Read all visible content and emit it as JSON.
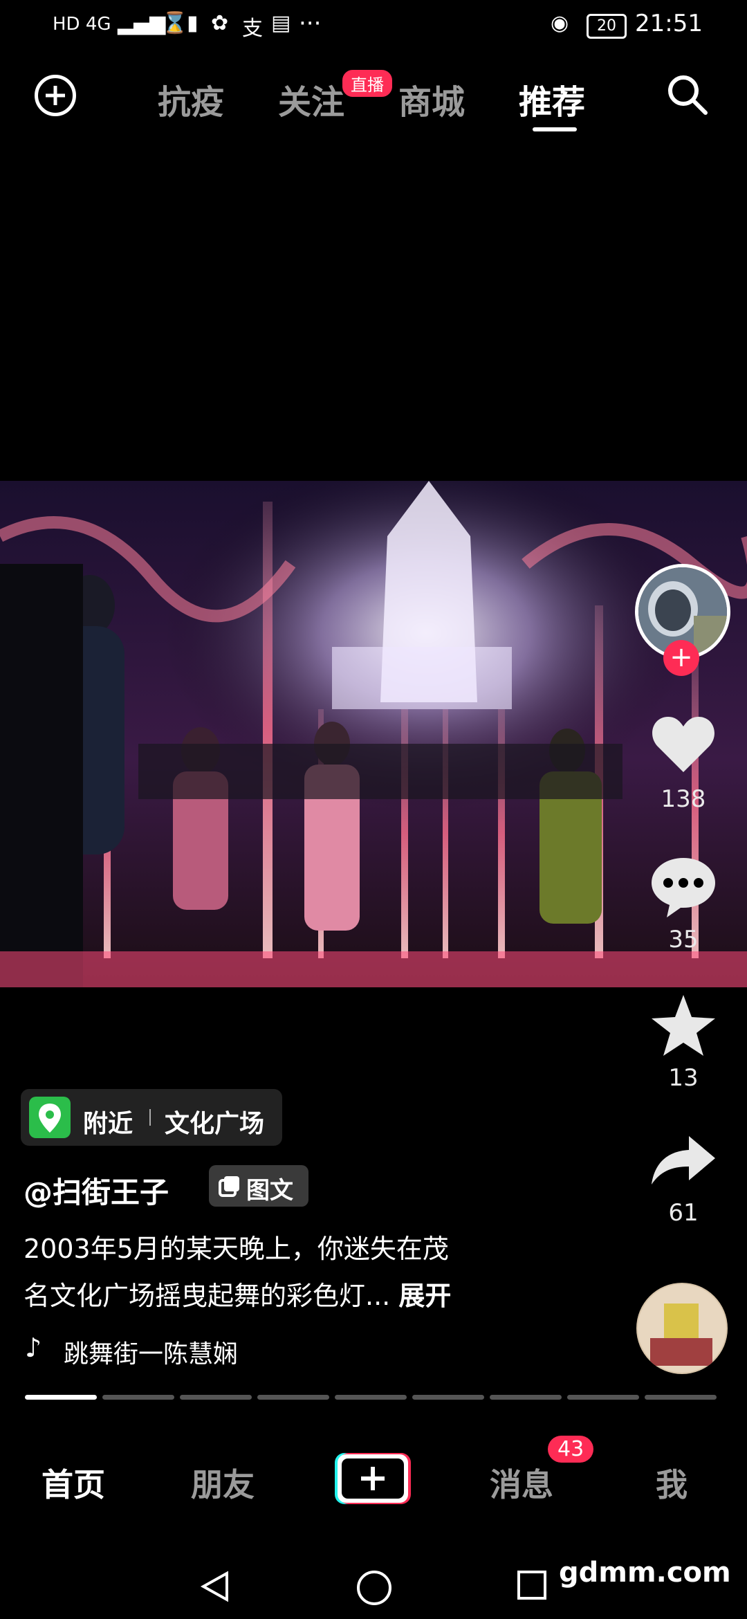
{
  "status_bar": {
    "left_icons_text": "HD 4G",
    "more": "···",
    "battery": "20",
    "time": "21:51"
  },
  "top_nav": {
    "tabs": [
      {
        "label": "抗疫"
      },
      {
        "label": "关注",
        "badge": "直播"
      },
      {
        "label": "商城"
      },
      {
        "label": "推荐",
        "active": true
      }
    ]
  },
  "right_rail": {
    "likes": "138",
    "comments": "35",
    "favorites": "13",
    "shares": "61"
  },
  "post": {
    "location_tag": "附近",
    "location_name": "文化广场",
    "username": "@扫街王子",
    "type_label": "图文",
    "description_line1": "2003年5月的某天晚上，你迷失在茂",
    "description_line2": "名文化广场摇曳起舞的彩色灯...",
    "expand": "展开",
    "music": "跳舞街一陈慧娴",
    "progress": {
      "segments": 9,
      "current": 1
    }
  },
  "bottom_nav": {
    "home": "首页",
    "friends": "朋友",
    "messages": "消息",
    "messages_badge": "43",
    "me": "我"
  },
  "system_nav": {
    "watermark": "gdmm.com"
  },
  "colors": {
    "accent": "#fe2c55",
    "location_green": "#2bbd4a"
  }
}
